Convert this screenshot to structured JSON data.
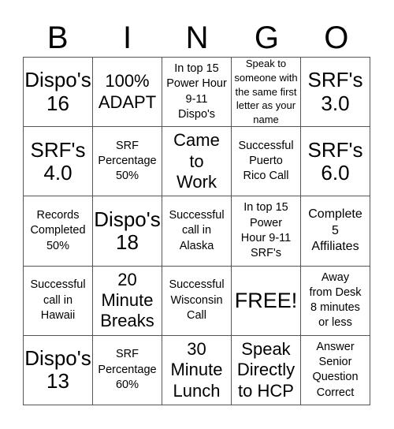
{
  "header": {
    "letters": [
      "B",
      "I",
      "N",
      "G",
      "O"
    ]
  },
  "cells": [
    [
      "Dispo's\n16",
      "100%\nADAPT",
      "In top 15\nPower Hour\n9-11\nDispo's",
      "Speak to\nsomeone with\nthe same first\nletter as your\nname",
      "SRF's\n3.0"
    ],
    [
      "SRF's\n4.0",
      "SRF\nPercentage\n50%",
      "Came\nto\nWork",
      "Successful\nPuerto\nRico Call",
      "SRF's\n6.0"
    ],
    [
      "Records\nCompleted\n50%",
      "Dispo's\n18",
      "Successful\ncall in\nAlaska",
      "In top 15\nPower\nHour 9-11\nSRF's",
      "Complete\n5\nAffiliates"
    ],
    [
      "Successful\ncall in\nHawaii",
      "20\nMinute\nBreaks",
      "Successful\nWisconsin\nCall",
      "FREE!",
      "Away\nfrom Desk\n8 minutes\nor less"
    ],
    [
      "Dispo's\n13",
      "SRF\nPercentage\n60%",
      "30\nMinute\nLunch",
      "Speak\nDirectly\nto HCP",
      "Answer\nSenior\nQuestion\nCorrect"
    ]
  ]
}
